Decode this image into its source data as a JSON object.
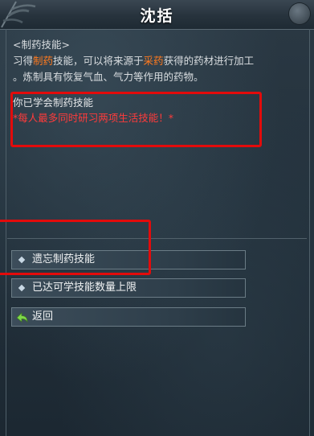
{
  "window": {
    "title": "沈括"
  },
  "description": {
    "header": "<制药技能>",
    "line1_pre": "习得",
    "line1_highlight1": "制药",
    "line1_mid": "技能，可以将来源于",
    "line1_highlight2": "采药",
    "line1_post": "获得的药材进行加工",
    "line2": "。炼制具有恢复气血、气力等作用的药物。"
  },
  "status": {
    "learned": "你已学会制药技能",
    "warning": "*每人最多同时研习两项生活技能！*"
  },
  "options": [
    {
      "label": "遗忘制药技能",
      "icon": "diamond-icon"
    },
    {
      "label": "已达可学技能数量上限",
      "icon": "diamond-icon"
    },
    {
      "label": "返回",
      "icon": "return-arrow-icon"
    }
  ],
  "colors": {
    "highlight": "#ff7a1f",
    "warning": "#ff3b3b",
    "annotation_red": "#e30b0b"
  }
}
